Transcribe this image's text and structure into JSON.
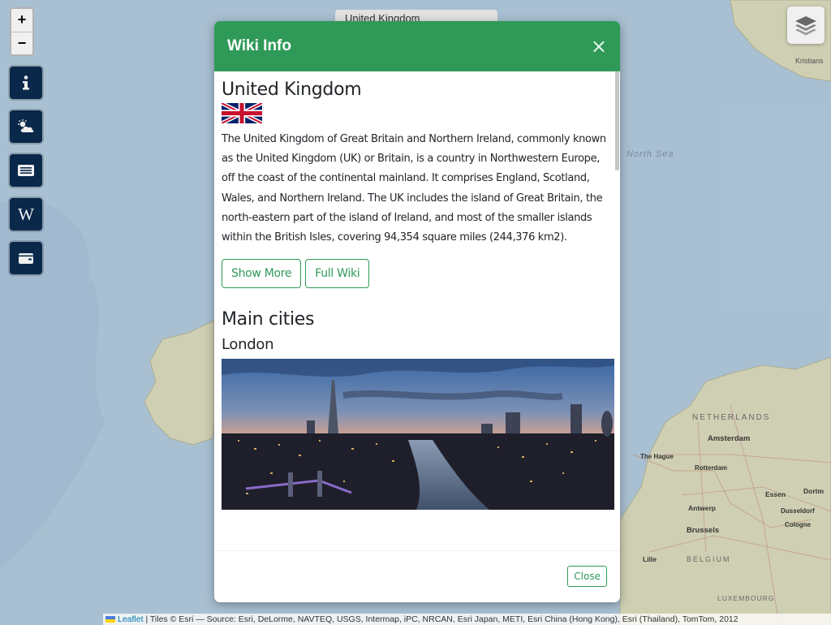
{
  "map": {
    "sea_label": "North Sea",
    "labels": {
      "netherlands": "NETHERLANDS",
      "amsterdam": "Amsterdam",
      "the_hague": "The Hague",
      "rotterdam": "Rotterdam",
      "essen": "Essen",
      "dortmund": "Dortm",
      "antwerp": "Antwerp",
      "dusseldorf": "Dusseldorf",
      "cologne": "Cologne",
      "brussels": "Brussels",
      "belgium": "BELGIUM",
      "lille": "Lille",
      "luxembourg": "LUXEMBOURG",
      "kristiansand": "Kristians"
    },
    "country_select_value": "United Kingdom",
    "zoom_in": "+",
    "zoom_out": "−"
  },
  "controls": {
    "icons": [
      "info-icon",
      "weather-icon",
      "news-icon",
      "wikipedia-icon",
      "wallet-icon"
    ],
    "wiki_letter": "W",
    "layers_icon": "layers-icon"
  },
  "modal": {
    "title": "Wiki Info",
    "close_x": "×",
    "country_name": "United Kingdom",
    "summary": "The United Kingdom of Great Britain and Northern Ireland, commonly known as the United Kingdom (UK) or Britain, is a country in Northwestern Europe, off the coast of the continental mainland. It comprises England, Scotland, Wales, and Northern Ireland. The UK includes the island of Great Britain, the north-eastern part of the island of Ireland, and most of the smaller islands within the British Isles, covering 94,354 square miles (244,376 km2).",
    "show_more_label": "Show More",
    "full_wiki_label": "Full Wiki",
    "main_cities_heading": "Main cities",
    "city_name": "London",
    "footer_close_label": "Close"
  },
  "attribution": {
    "leaflet": "Leaflet",
    "text": " | Tiles © Esri — Source: Esri, DeLorme, NAVTEQ, USGS, Intermap, iPC, NRCAN, Esri Japan, METI, Esri China (Hong Kong), Esri (Thailand), TomTom, 2012"
  },
  "colors": {
    "header_green": "#2f9a58",
    "control_navy": "#0b2b4f",
    "sea": "#b5cfe0",
    "land": "#d9dcc0"
  }
}
